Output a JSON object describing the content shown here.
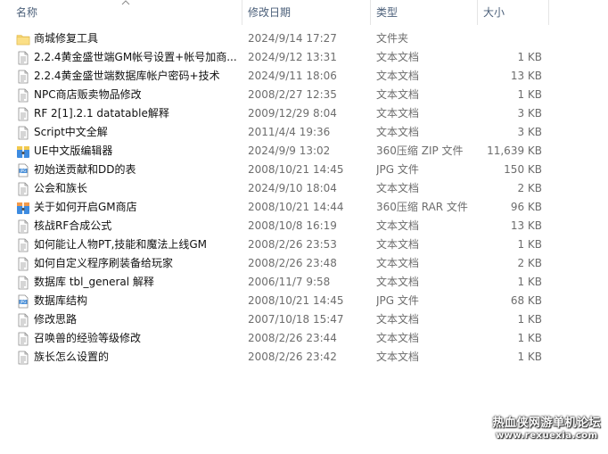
{
  "columns": {
    "name": "名称",
    "date": "修改日期",
    "type": "类型",
    "size": "大小"
  },
  "files": [
    {
      "name": "商城修复工具",
      "date": "2024/9/14 17:27",
      "type": "文件夹",
      "size": "",
      "icon": "folder-icon"
    },
    {
      "name": "2.2.4黄金盛世端GM帐号设置+帐号加商...",
      "date": "2024/9/12 13:31",
      "type": "文本文档",
      "size": "1 KB",
      "icon": "text-file-icon"
    },
    {
      "name": "2.2.4黄金盛世端数据库帐户密码+技术",
      "date": "2024/9/11 18:06",
      "type": "文本文档",
      "size": "13 KB",
      "icon": "text-file-icon"
    },
    {
      "name": "NPC商店贩卖物品修改",
      "date": "2008/2/27 12:35",
      "type": "文本文档",
      "size": "1 KB",
      "icon": "text-file-icon"
    },
    {
      "name": "RF 2[1].2.1 datatable解释",
      "date": "2009/12/29 8:04",
      "type": "文本文档",
      "size": "3 KB",
      "icon": "text-file-icon"
    },
    {
      "name": "Script中文全解",
      "date": "2011/4/4 19:36",
      "type": "文本文档",
      "size": "3 KB",
      "icon": "text-file-icon"
    },
    {
      "name": "UE中文版编辑器",
      "date": "2024/9/9 13:02",
      "type": "360压缩 ZIP 文件",
      "size": "11,639 KB",
      "icon": "zip-archive-icon"
    },
    {
      "name": "初始送贡献和DD的表",
      "date": "2008/10/21 14:45",
      "type": "JPG 文件",
      "size": "150 KB",
      "icon": "jpg-image-icon"
    },
    {
      "name": "公会和族长",
      "date": "2024/9/10 18:04",
      "type": "文本文档",
      "size": "2 KB",
      "icon": "text-file-icon"
    },
    {
      "name": "关于如何开启GM商店",
      "date": "2008/10/21 14:44",
      "type": "360压缩 RAR 文件",
      "size": "96 KB",
      "icon": "rar-archive-icon"
    },
    {
      "name": "核战RF合成公式",
      "date": "2008/10/8 16:19",
      "type": "文本文档",
      "size": "13 KB",
      "icon": "text-file-icon"
    },
    {
      "name": "如何能让人物PT,技能和魔法上线GM",
      "date": "2008/2/26 23:53",
      "type": "文本文档",
      "size": "1 KB",
      "icon": "text-file-icon"
    },
    {
      "name": "如何自定义程序刷装备给玩家",
      "date": "2008/2/26 23:48",
      "type": "文本文档",
      "size": "2 KB",
      "icon": "text-file-icon"
    },
    {
      "name": "数据库 tbl_general 解释",
      "date": "2006/11/7 9:58",
      "type": "文本文档",
      "size": "1 KB",
      "icon": "text-file-icon"
    },
    {
      "name": "数据库结构",
      "date": "2008/10/21 14:45",
      "type": "JPG 文件",
      "size": "68 KB",
      "icon": "jpg-image-icon"
    },
    {
      "name": "修改思路",
      "date": "2007/10/18 15:47",
      "type": "文本文档",
      "size": "1 KB",
      "icon": "text-file-icon"
    },
    {
      "name": "召唤兽的经验等级修改",
      "date": "2008/2/26 23:44",
      "type": "文本文档",
      "size": "1 KB",
      "icon": "text-file-icon"
    },
    {
      "name": "族长怎么设置的",
      "date": "2008/2/26 23:42",
      "type": "文本文档",
      "size": "1 KB",
      "icon": "text-file-icon"
    }
  ],
  "watermark": {
    "line1": "热血侠网游单机论坛",
    "line2": "www.rexuexia.com"
  },
  "colors": {
    "header_text": "#4c607a",
    "detail_text": "#6d6d6d",
    "folder": "#f8d775",
    "text_file_border": "#8a8a8a"
  }
}
